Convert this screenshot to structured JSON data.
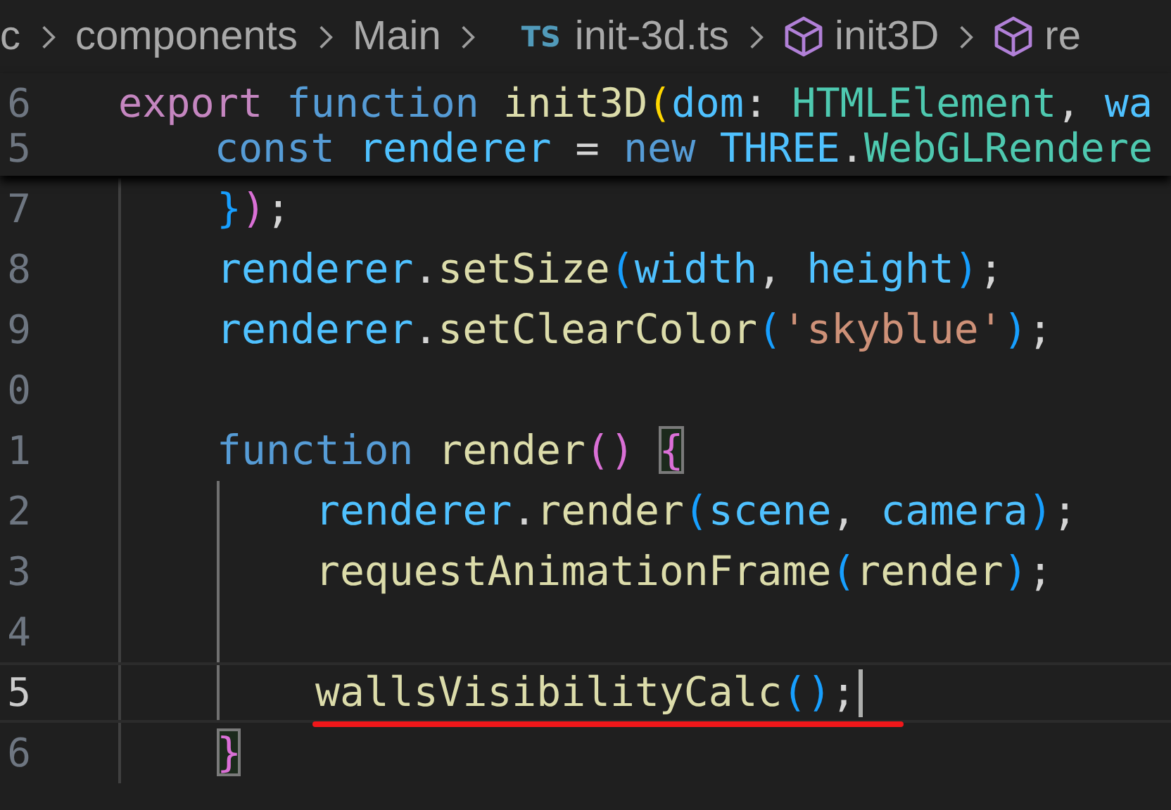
{
  "breadcrumb": [
    {
      "label": "c",
      "kind": "folder"
    },
    {
      "label": "components",
      "kind": "folder"
    },
    {
      "label": "Main",
      "kind": "folder"
    },
    {
      "label": "init-3d.ts",
      "kind": "ts-file"
    },
    {
      "label": "init3D",
      "kind": "symbol"
    },
    {
      "label": "re",
      "kind": "symbol"
    }
  ],
  "breadcrumb_badge": "TS",
  "sticky_lines": [
    {
      "number": "6",
      "tokens": [
        {
          "text": "export ",
          "kind": "keyword"
        },
        {
          "text": "function ",
          "kind": "storage"
        },
        {
          "text": "init3D",
          "kind": "function"
        },
        {
          "text": "(",
          "kind": "bracket1"
        },
        {
          "text": "dom",
          "kind": "variable"
        },
        {
          "text": ": ",
          "kind": "punct"
        },
        {
          "text": "HTMLElement",
          "kind": "type"
        },
        {
          "text": ", ",
          "kind": "punct"
        },
        {
          "text": "wa",
          "kind": "variable"
        }
      ]
    },
    {
      "number": "5",
      "tokens": [
        {
          "text": "    const ",
          "kind": "storage"
        },
        {
          "text": "renderer",
          "kind": "variable"
        },
        {
          "text": " = ",
          "kind": "punct"
        },
        {
          "text": "new ",
          "kind": "storage"
        },
        {
          "text": "THREE",
          "kind": "variable"
        },
        {
          "text": ".",
          "kind": "punct"
        },
        {
          "text": "WebGLRendere",
          "kind": "type"
        }
      ]
    }
  ],
  "lines": [
    {
      "number": "7",
      "current": false,
      "tokens": [
        {
          "text": "    }",
          "kind": "bracket3"
        },
        {
          "text": ")",
          "kind": "bracket2"
        },
        {
          "text": ";",
          "kind": "punct"
        }
      ]
    },
    {
      "number": "8",
      "current": false,
      "tokens": [
        {
          "text": "    renderer",
          "kind": "variable"
        },
        {
          "text": ".",
          "kind": "punct"
        },
        {
          "text": "setSize",
          "kind": "function"
        },
        {
          "text": "(",
          "kind": "bracket3"
        },
        {
          "text": "width",
          "kind": "variable"
        },
        {
          "text": ", ",
          "kind": "punct"
        },
        {
          "text": "height",
          "kind": "variable"
        },
        {
          "text": ")",
          "kind": "bracket3"
        },
        {
          "text": ";",
          "kind": "punct"
        }
      ]
    },
    {
      "number": "9",
      "current": false,
      "tokens": [
        {
          "text": "    renderer",
          "kind": "variable"
        },
        {
          "text": ".",
          "kind": "punct"
        },
        {
          "text": "setClearColor",
          "kind": "function"
        },
        {
          "text": "(",
          "kind": "bracket3"
        },
        {
          "text": "'skyblue'",
          "kind": "string"
        },
        {
          "text": ")",
          "kind": "bracket3"
        },
        {
          "text": ";",
          "kind": "punct"
        }
      ]
    },
    {
      "number": "0",
      "current": false
    },
    {
      "number": "1",
      "current": false,
      "tokens": [
        {
          "text": "    function ",
          "kind": "storage"
        },
        {
          "text": "render",
          "kind": "function"
        },
        {
          "text": "() ",
          "kind": "bracket2"
        },
        {
          "text": "{",
          "kind": "bracket2-box"
        }
      ]
    },
    {
      "number": "2",
      "current": false,
      "tokens": [
        {
          "text": "        renderer",
          "kind": "variable"
        },
        {
          "text": ".",
          "kind": "punct"
        },
        {
          "text": "render",
          "kind": "function"
        },
        {
          "text": "(",
          "kind": "bracket3"
        },
        {
          "text": "scene",
          "kind": "variable"
        },
        {
          "text": ", ",
          "kind": "punct"
        },
        {
          "text": "camera",
          "kind": "variable"
        },
        {
          "text": ")",
          "kind": "bracket3"
        },
        {
          "text": ";",
          "kind": "punct"
        }
      ]
    },
    {
      "number": "3",
      "current": false,
      "tokens": [
        {
          "text": "        requestAnimationFrame",
          "kind": "function"
        },
        {
          "text": "(",
          "kind": "bracket3"
        },
        {
          "text": "render",
          "kind": "function"
        },
        {
          "text": ")",
          "kind": "bracket3"
        },
        {
          "text": ";",
          "kind": "punct"
        }
      ]
    },
    {
      "number": "4",
      "current": false
    },
    {
      "number": "5",
      "current": true,
      "underlined": true,
      "tokens": [
        {
          "text": "        wallsVisibilityCalc",
          "kind": "function"
        },
        {
          "text": "()",
          "kind": "bracket3"
        },
        {
          "text": ";",
          "kind": "punct"
        }
      ]
    },
    {
      "number": "6",
      "current": false,
      "tokens": [
        {
          "text": "    }",
          "kind": "bracket2-box"
        }
      ]
    }
  ]
}
